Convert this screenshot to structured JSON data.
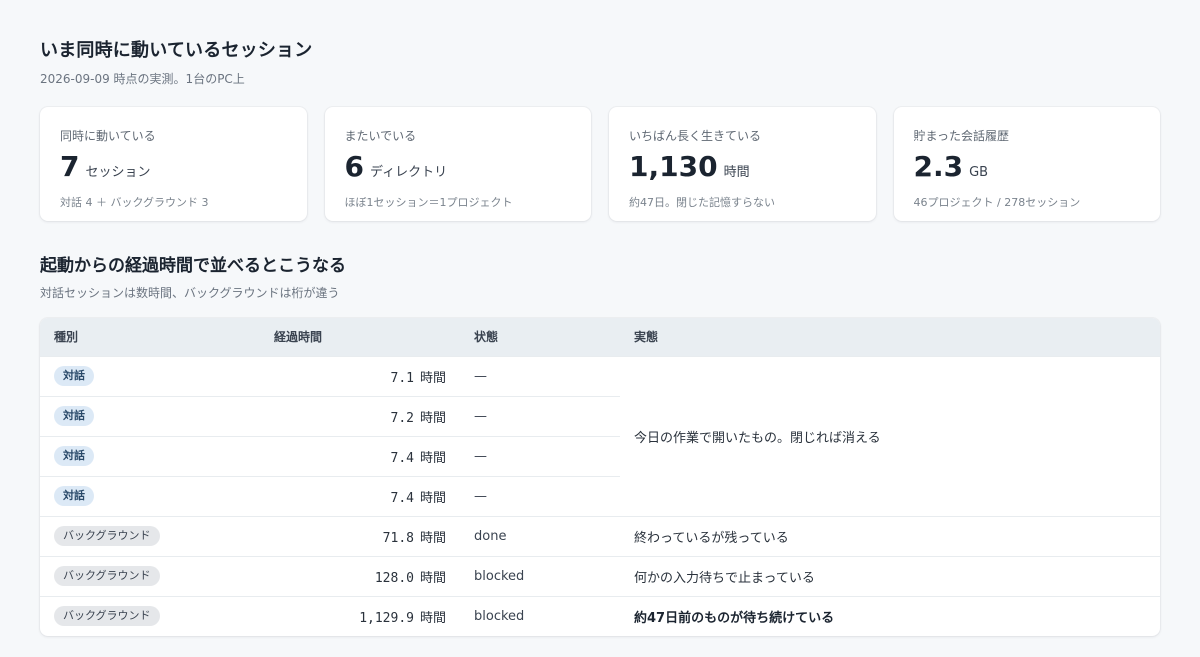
{
  "header": {
    "title": "いま同時に動いているセッション",
    "subtitle": "2026-09-09 時点の実測。1台のPC上"
  },
  "cards": [
    {
      "label": "同時に動いている",
      "value": "7",
      "unit": "セッション",
      "note": "対話 4 ＋ バックグラウンド 3"
    },
    {
      "label": "またいでいる",
      "value": "6",
      "unit": "ディレクトリ",
      "note": "ほぼ1セッション＝1プロジェクト"
    },
    {
      "label": "いちばん長く生きている",
      "value": "1,130",
      "unit": "時間",
      "note": "約47日。閉じた記憶すらない"
    },
    {
      "label": "貯まった会話履歴",
      "value": "2.3",
      "unit": "GB",
      "note": "46プロジェクト / 278セッション"
    }
  ],
  "section": {
    "title": "起動からの経過時間で並べるとこうなる",
    "subtitle": "対話セッションは数時間、バックグラウンドは桁が違う"
  },
  "table": {
    "headers": {
      "kind": "種別",
      "elapsed": "経過時間",
      "state": "状態",
      "reality": "実態"
    },
    "hour_unit": "時間",
    "rows": [
      {
        "kind": "対話",
        "kind_type": "talk",
        "elapsed": "7.1",
        "state": "—"
      },
      {
        "kind": "対話",
        "kind_type": "talk",
        "elapsed": "7.2",
        "state": "—"
      },
      {
        "kind": "対話",
        "kind_type": "talk",
        "elapsed": "7.4",
        "state": "—"
      },
      {
        "kind": "対話",
        "kind_type": "talk",
        "elapsed": "7.4",
        "state": "—"
      },
      {
        "kind": "バックグラウンド",
        "kind_type": "bg",
        "elapsed": "71.8",
        "state": "done",
        "reality": "終わっているが残っている"
      },
      {
        "kind": "バックグラウンド",
        "kind_type": "bg",
        "elapsed": "128.0",
        "state": "blocked",
        "reality": "何かの入力待ちで止まっている"
      },
      {
        "kind": "バックグラウンド",
        "kind_type": "bg",
        "elapsed": "1,129.9",
        "state": "blocked",
        "reality": "約47日前のものが待ち続けている"
      }
    ],
    "merged_reality": "今日の作業で開いたもの。閉じれば消える"
  },
  "colors": {
    "background": "#f6f8fa",
    "card": "#ffffff",
    "table_header": "#e9eef2",
    "badge_talk": "#dce9f6",
    "badge_bg": "#e5e7ea"
  }
}
